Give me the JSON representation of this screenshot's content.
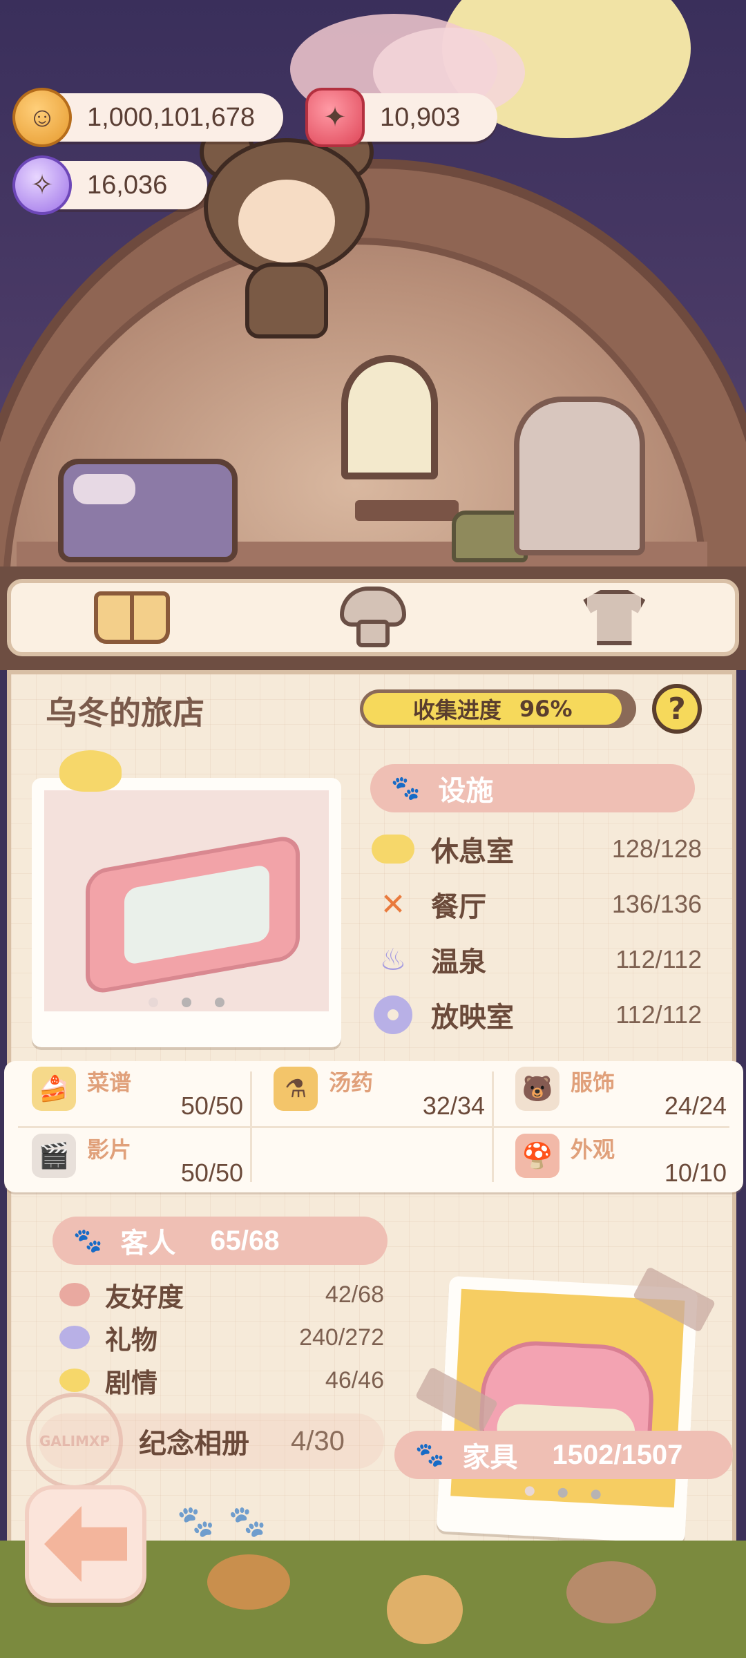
{
  "currencies": {
    "coins": "1,000,101,678",
    "candles": "10,903",
    "gems": "16,036"
  },
  "tabs": [
    {
      "icon": "book-icon"
    },
    {
      "icon": "hotel-icon"
    },
    {
      "icon": "shirt-icon"
    }
  ],
  "panel": {
    "title": "乌冬的旅店",
    "progress_label": "收集进度",
    "progress_value": "96%",
    "progress_fraction": 0.96,
    "help": "?"
  },
  "facilities": {
    "banner": "设施",
    "items": [
      {
        "name": "休息室",
        "value": "128/128",
        "icon": "cloud-icon"
      },
      {
        "name": "餐厅",
        "value": "136/136",
        "icon": "fork-knife-icon"
      },
      {
        "name": "温泉",
        "value": "112/112",
        "icon": "hot-spring-icon"
      },
      {
        "name": "放映室",
        "value": "112/112",
        "icon": "film-reel-icon"
      }
    ]
  },
  "collections": [
    {
      "name": "菜谱",
      "value": "50/50",
      "icon": "recipe-icon"
    },
    {
      "name": "汤药",
      "value": "32/34",
      "icon": "potion-icon"
    },
    {
      "name": "服饰",
      "value": "24/24",
      "icon": "outfit-icon"
    },
    {
      "name": "影片",
      "value": "50/50",
      "icon": "film-icon"
    },
    {
      "name": "外观",
      "value": "10/10",
      "icon": "exterior-icon"
    }
  ],
  "guests": {
    "banner": "客人",
    "value": "65/68",
    "items": [
      {
        "name": "友好度",
        "value": "42/68",
        "color": "#e9a9a0"
      },
      {
        "name": "礼物",
        "value": "240/272",
        "color": "#b8b0e6"
      },
      {
        "name": "剧情",
        "value": "46/46",
        "color": "#f6d76a"
      }
    ]
  },
  "album": {
    "label": "纪念相册",
    "value": "4/30",
    "stamp_text": "GALIMXP"
  },
  "furniture": {
    "banner": "家具",
    "value": "1502/1507"
  }
}
